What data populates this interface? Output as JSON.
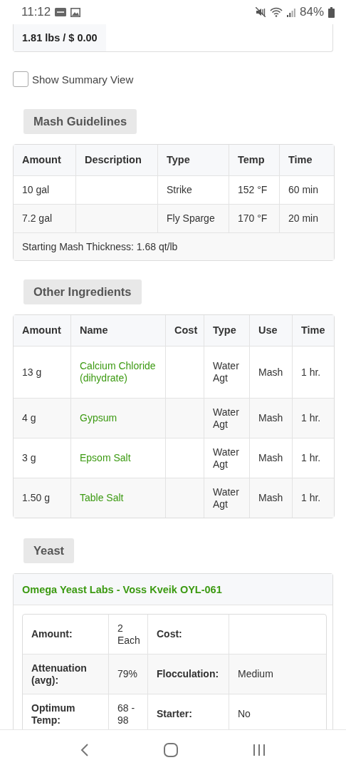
{
  "status_bar": {
    "time": "11:12",
    "battery": "84%"
  },
  "summary": {
    "text": "1.81 lbs / $ 0.00"
  },
  "show_summary": {
    "label": "Show Summary View",
    "checked": false
  },
  "mash": {
    "heading": "Mash Guidelines",
    "columns": [
      "Amount",
      "Description",
      "Type",
      "Temp",
      "Time"
    ],
    "rows": [
      {
        "amount": "10 gal",
        "type": "Strike",
        "temp": "152 °F",
        "time": "60 min"
      },
      {
        "amount": "7.2 gal",
        "type": "Fly Sparge",
        "temp": "170 °F",
        "time": "20 min"
      }
    ],
    "footer": "Starting Mash Thickness: 1.68 qt/lb"
  },
  "other": {
    "heading": "Other Ingredients",
    "columns": [
      "Amount",
      "Name",
      "Cost",
      "Type",
      "Use",
      "Time"
    ],
    "rows": [
      {
        "amount": "13 g",
        "name": "Calcium Chloride (dihydrate)",
        "type": "Water Agt",
        "use": "Mash",
        "time": "1 hr."
      },
      {
        "amount": "4 g",
        "name": "Gypsum",
        "type": "Water Agt",
        "use": "Mash",
        "time": "1 hr."
      },
      {
        "amount": "3 g",
        "name": "Epsom Salt",
        "type": "Water Agt",
        "use": "Mash",
        "time": "1 hr."
      },
      {
        "amount": "1.50 g",
        "name": "Table Salt",
        "type": "Water Agt",
        "use": "Mash",
        "time": "1 hr."
      }
    ]
  },
  "yeast": {
    "heading": "Yeast",
    "name": "Omega Yeast Labs - Voss Kveik OYL-061",
    "details": [
      {
        "label": "Amount:",
        "value": "2 Each"
      },
      {
        "label": "Cost:"
      },
      {
        "label": "Attenuation (avg):",
        "value": "79%"
      },
      {
        "label": "Flocculation:",
        "value": "Medium"
      },
      {
        "label": "Optimum Temp:",
        "value": "68 - 98"
      },
      {
        "label": "Starter:",
        "value": "No"
      }
    ]
  }
}
